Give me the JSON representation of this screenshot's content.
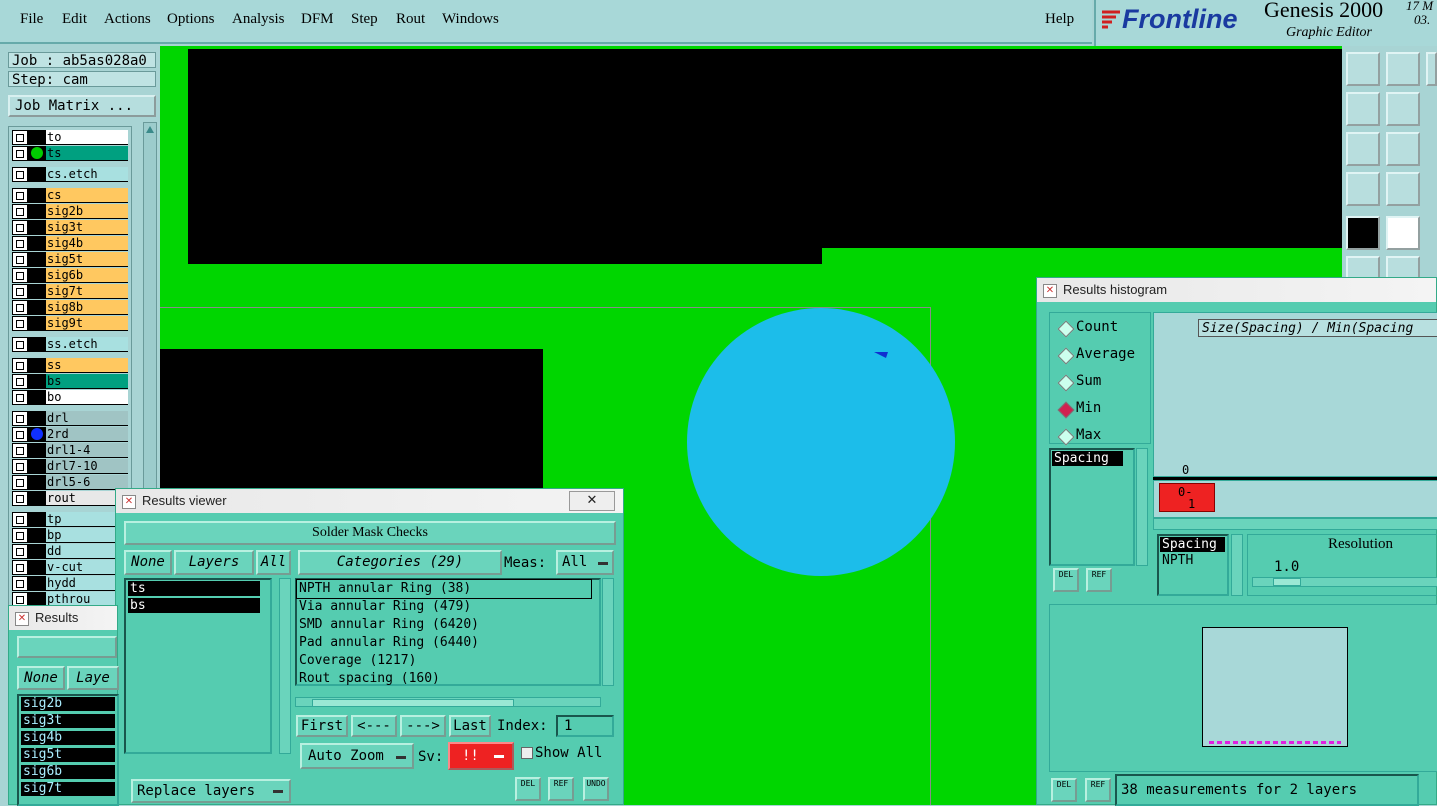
{
  "menu": [
    "File",
    "Edit",
    "Actions",
    "Options",
    "Analysis",
    "DFM",
    "Step",
    "Rout",
    "Windows"
  ],
  "help": "Help",
  "brand": {
    "logo": "Frontline",
    "product": "Genesis 2000",
    "subtitle": "Graphic Editor",
    "date1": "17 M",
    "date2": "03."
  },
  "job": {
    "job_label": "Job : ab5as028a0",
    "step_label": "Step: cam",
    "matrix_button": "Job Matrix ..."
  },
  "layers": [
    {
      "name": "to",
      "color": "#ffffff",
      "dot": ""
    },
    {
      "name": "ts",
      "color": "#00a080",
      "dot": "#00cc00"
    },
    {
      "name": "cs.etch",
      "color": "#a8e0e0",
      "dot": ""
    },
    {
      "name": "cs",
      "color": "#ffc860",
      "dot": ""
    },
    {
      "name": "sig2b",
      "color": "#ffc860",
      "dot": ""
    },
    {
      "name": "sig3t",
      "color": "#ffc860",
      "dot": ""
    },
    {
      "name": "sig4b",
      "color": "#ffc860",
      "dot": ""
    },
    {
      "name": "sig5t",
      "color": "#ffc860",
      "dot": ""
    },
    {
      "name": "sig6b",
      "color": "#ffc860",
      "dot": ""
    },
    {
      "name": "sig7t",
      "color": "#ffc860",
      "dot": ""
    },
    {
      "name": "sig8b",
      "color": "#ffc860",
      "dot": ""
    },
    {
      "name": "sig9t",
      "color": "#ffc860",
      "dot": ""
    },
    {
      "name": "ss.etch",
      "color": "#a8e0e0",
      "dot": ""
    },
    {
      "name": "ss",
      "color": "#ffc860",
      "dot": ""
    },
    {
      "name": "bs",
      "color": "#00a080",
      "dot": ""
    },
    {
      "name": "bo",
      "color": "#ffffff",
      "dot": ""
    },
    {
      "name": "drl",
      "color": "#a0c4c4",
      "dot": ""
    },
    {
      "name": "2rd",
      "color": "#a0c4c4",
      "dot": "#1030ff"
    },
    {
      "name": "drl1-4",
      "color": "#a0c4c4",
      "dot": ""
    },
    {
      "name": "drl7-10",
      "color": "#a0c4c4",
      "dot": ""
    },
    {
      "name": "drl5-6",
      "color": "#a0c4c4",
      "dot": ""
    },
    {
      "name": "rout",
      "color": "#e8e8e8",
      "dot": ""
    },
    {
      "name": "tp",
      "color": "#a8e0e0",
      "dot": ""
    },
    {
      "name": "bp",
      "color": "#a8e0e0",
      "dot": ""
    },
    {
      "name": "dd",
      "color": "#a8e0e0",
      "dot": ""
    },
    {
      "name": "v-cut",
      "color": "#a8e0e0",
      "dot": ""
    },
    {
      "name": "hydd",
      "color": "#a8e0e0",
      "dot": ""
    },
    {
      "name": "pthrou",
      "color": "#a8e0e0",
      "dot": ""
    }
  ],
  "results_viewer": {
    "title": "Results viewer",
    "header": "Solder Mask Checks",
    "none": "None",
    "layers": "Layers",
    "all": "All",
    "categories": "Categories (29)",
    "meas_label": "Meas:",
    "meas_value": "All",
    "layer_list": [
      "ts",
      "bs"
    ],
    "category_list": [
      "NPTH annular Ring (38)",
      "Via annular Ring (479)",
      "SMD annular Ring (6420)",
      "Pad annular Ring (6440)",
      "Coverage (1217)",
      "Rout spacing (160)"
    ],
    "first": "First",
    "prev": "<---",
    "next": "--->",
    "last": "Last",
    "index_label": "Index:",
    "index_value": "1",
    "auto_zoom": "Auto Zoom",
    "sv_label": "Sv:",
    "sv_value": "!!",
    "show_all": "Show All",
    "replace_layers": "Replace layers",
    "del": "DEL",
    "ref": "REF",
    "undo": "UNDO"
  },
  "results_viewer2": {
    "title": "Results viewer",
    "none": "None",
    "layers": "Laye",
    "list": [
      "sig2b",
      "sig3t",
      "sig4b",
      "sig5t",
      "sig6b",
      "sig7t"
    ]
  },
  "histogram": {
    "title": "Results histogram",
    "options": [
      "Count",
      "Average",
      "Sum",
      "Min",
      "Max"
    ],
    "selected": "Min",
    "list": [
      "Spacing"
    ],
    "chart_label": "Size(Spacing) / Min(Spacing",
    "axis_zero": "0",
    "bar_label_top": "0-",
    "bar_label_bottom": "1",
    "type_list": [
      "Spacing",
      "NPTH"
    ],
    "resolution_label": "Resolution",
    "resolution_value": "1.0",
    "del": "DEL",
    "ref": "REF",
    "status": "38 measurements for 2 layers"
  }
}
